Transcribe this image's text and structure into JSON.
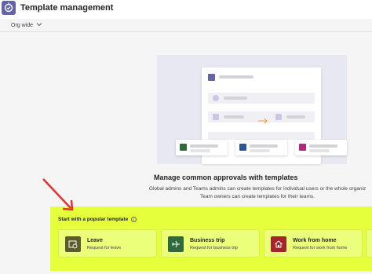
{
  "app": {
    "title": "Template management",
    "icon": "approvals-app-icon",
    "accent": "#6264a7"
  },
  "filter": {
    "label": "Org wide",
    "icon": "chevron-down-icon"
  },
  "hero": {
    "heading": "Manage common approvals with templates",
    "subtext_line1": "Global admins and Teams admins can create templates for individual users or the whole organiz",
    "subtext_line2": "Team owners can create templates for their teams."
  },
  "popular": {
    "label": "Start with a popular template",
    "highlight_color": "#e6ff3d",
    "templates": [
      {
        "title": "Leave",
        "description": "Request for leave",
        "icon": "calendar-clock-icon",
        "color": "#5b5b2e"
      },
      {
        "title": "Business trip",
        "description": "Request for business trip",
        "icon": "airplane-icon",
        "color": "#2f6b3a"
      },
      {
        "title": "Work from home",
        "description": "Request for work from home",
        "icon": "home-icon",
        "color": "#a4262c"
      }
    ]
  },
  "annotation": {
    "arrow_color": "#e8302e"
  }
}
